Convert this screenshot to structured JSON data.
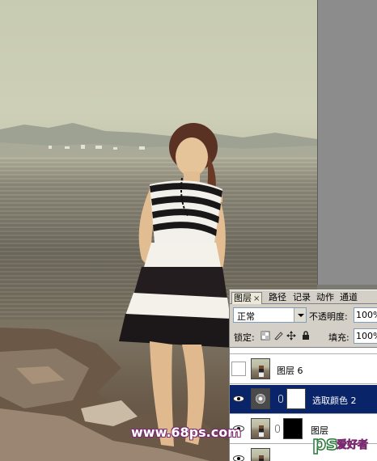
{
  "panel": {
    "tabs": [
      {
        "label": "图层",
        "close": "×"
      },
      {
        "label": "路径"
      },
      {
        "label": "记录"
      },
      {
        "label": "动作"
      },
      {
        "label": "通道"
      }
    ],
    "blend_mode": "正常",
    "opacity_label": "不透明度:",
    "opacity_value": "100%",
    "lock_label": "锁定:",
    "fill_label": "填充:",
    "fill_value": "100%",
    "layers": [
      {
        "name": "图层 6",
        "visible": false,
        "selected": false
      },
      {
        "name": "选取颜色 2",
        "visible": true,
        "selected": true
      },
      {
        "name": "图层",
        "visible": true,
        "selected": false
      }
    ]
  },
  "watermark": {
    "site": "www.68ps.com",
    "logo": "ps爱好者"
  },
  "colors": {
    "selection": "#0a246a",
    "panel_bg": "#d4d0c8",
    "watermark": "#7a2a70"
  }
}
